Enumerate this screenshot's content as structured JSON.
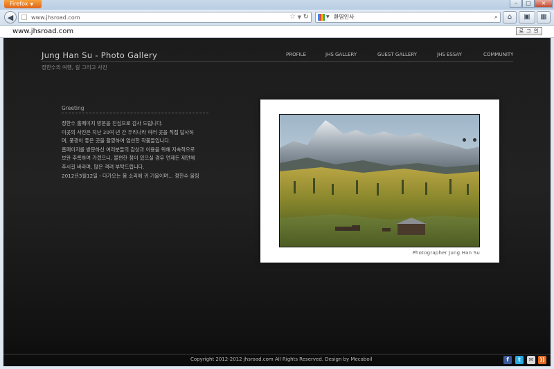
{
  "browser": {
    "app_button": "Firefox",
    "url": "www.jhsroad.com",
    "search_query": "환영인사",
    "bookmark_label": "www.jhsroad.com",
    "login_label": "로 그 인",
    "window_controls": {
      "minimize": "–",
      "maximize": "□",
      "close": "×"
    }
  },
  "site": {
    "title": "Jung Han Su - Photo Gallery",
    "subtitle": "정한수의 여행, 길 그리고 사진",
    "nav": [
      "PROFILE",
      "JHS GALLERY",
      "GUEST GALLERY",
      "JHS ESSAY",
      "COMMUNITY"
    ]
  },
  "greeting": {
    "title": "Greeting",
    "lines": [
      "정한수 홈페이지 방문을 진심으로 감사 드립니다.",
      "이곳의 사진은 지난 20여 년 간 우리나라 여러 곳을 직접 답사하",
      "며, 풍광이 좋은 곳을 촬영하여 엄선한 작품들입니다.",
      "홈페이지를 방문하신 여러분들의 감상과 이용을 위해 지속적으로",
      "보완 추록하여 가겠으니, 불편한 점이 있으실 경우 언제든 제언해",
      "주시길 바라며, 많은 격려 부탁드립니다.",
      "2012년3월12일 - 다가오는 봄 소리에 귀 기울이며... 정한수 올림"
    ]
  },
  "photo": {
    "caption": "Photographer   Jung Han Su",
    "description_icon": "landscape-photo"
  },
  "footer": {
    "copyright": "Copyright 2012-2012 jhsroad.com All Rights Reserved.      Design by Mecaboil",
    "social_icons": [
      "facebook-icon",
      "twitter-icon",
      "email-icon",
      "rss-icon"
    ]
  },
  "colors": {
    "page_bg": "#1c1c1c",
    "firefox_orange": "#e0661b",
    "facebook": "#3b5998",
    "twitter": "#29a9e1",
    "rss": "#e8691d"
  }
}
